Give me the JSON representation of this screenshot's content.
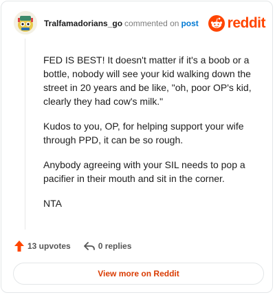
{
  "header": {
    "username": "Tralfamadorians_go",
    "commented_text": "commented on",
    "post_link": "post",
    "brand": "reddit"
  },
  "comment": {
    "paragraphs": [
      "FED IS BEST! It doesn't matter if it's a boob or a bottle, nobody will see your kid walking down the street in 20 years and be like, \"oh, poor OP's kid, clearly they had cow's milk.\"",
      "Kudos to you, OP, for helping support your wife through PPD, it can be so rough.",
      "Anybody agreeing with your SIL needs to pop a pacifier in their mouth and sit in the corner.",
      "NTA"
    ]
  },
  "actions": {
    "upvotes": "13 upvotes",
    "replies": "0 replies"
  },
  "cta": {
    "label": "View more on Reddit"
  },
  "colors": {
    "brand": "#ff4500",
    "link": "#0079d3",
    "cta_text": "#d93a00"
  },
  "icons": [
    "avatar",
    "reddit-logo-icon",
    "upvote-arrow-icon",
    "reply-arrow-icon"
  ]
}
